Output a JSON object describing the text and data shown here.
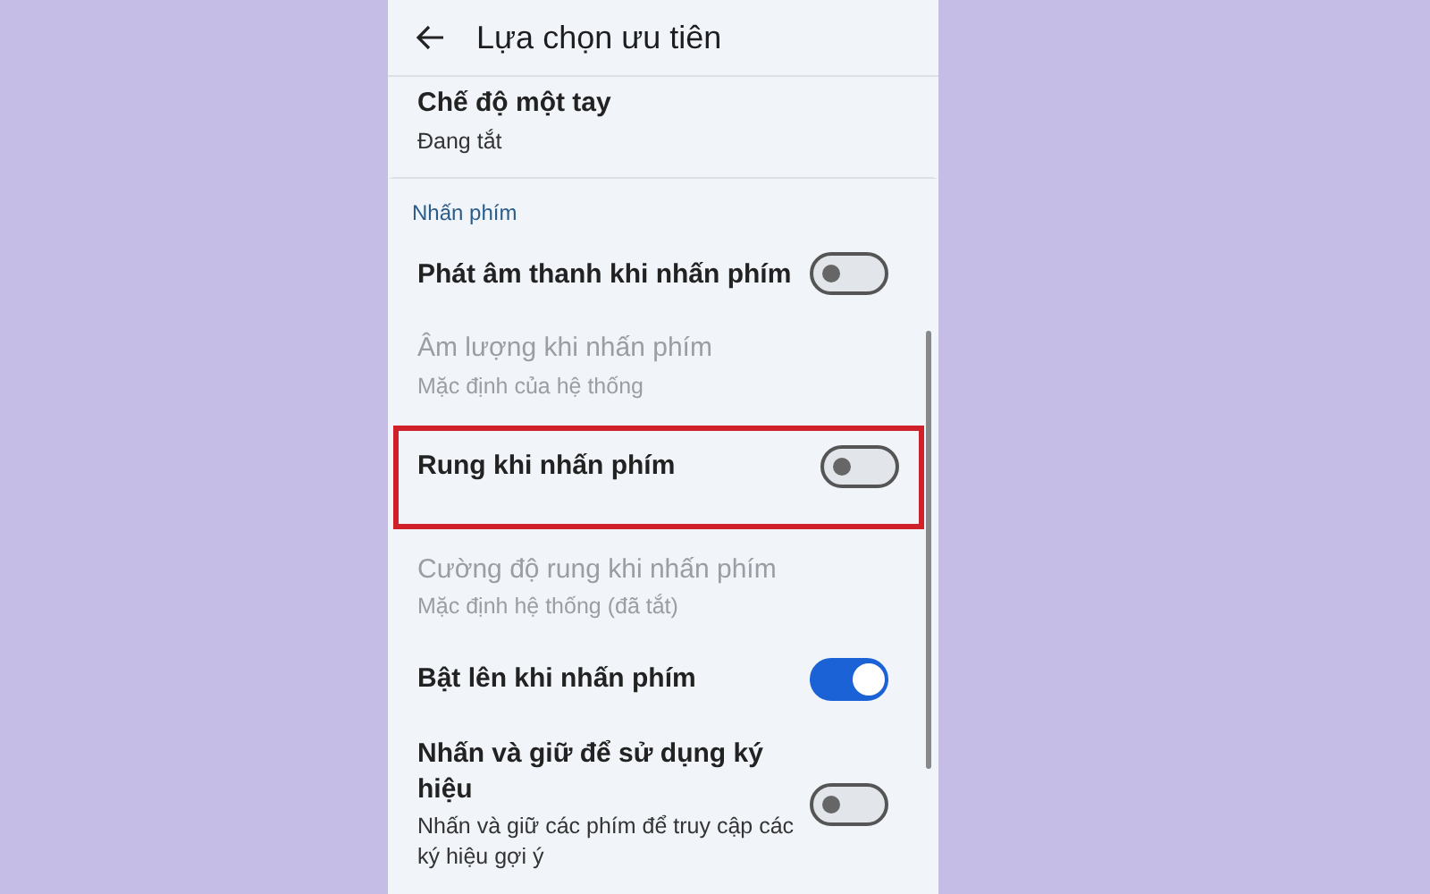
{
  "header": {
    "title": "Lựa chọn ưu tiên"
  },
  "items": [
    {
      "kind": "link",
      "title": "Chế độ một tay",
      "subtitle": "Đang tắt",
      "disabled": false,
      "highlighted": false
    },
    {
      "kind": "section",
      "title": "Nhấn phím"
    },
    {
      "kind": "toggle",
      "title": "Phát âm thanh khi nhấn phím",
      "disabled": false,
      "highlighted": false,
      "on": false
    },
    {
      "kind": "link",
      "title": "Âm lượng khi nhấn phím",
      "subtitle": "Mặc định của hệ thống",
      "disabled": true,
      "highlighted": false
    },
    {
      "kind": "toggle",
      "title": "Rung khi nhấn phím",
      "disabled": false,
      "highlighted": true,
      "on": false
    },
    {
      "kind": "link",
      "title": "Cường độ rung khi nhấn phím",
      "subtitle": "Mặc định hệ thống (đã tắt)",
      "disabled": true,
      "highlighted": false
    },
    {
      "kind": "toggle",
      "title": "Bật lên khi nhấn phím",
      "disabled": false,
      "highlighted": false,
      "on": true
    },
    {
      "kind": "toggle",
      "title": "Nhấn và giữ để sử dụng ký hiệu",
      "subtitle": "Nhấn và giữ các phím để truy cập các ký hiệu gợi ý",
      "disabled": false,
      "highlighted": false,
      "on": false
    }
  ]
}
